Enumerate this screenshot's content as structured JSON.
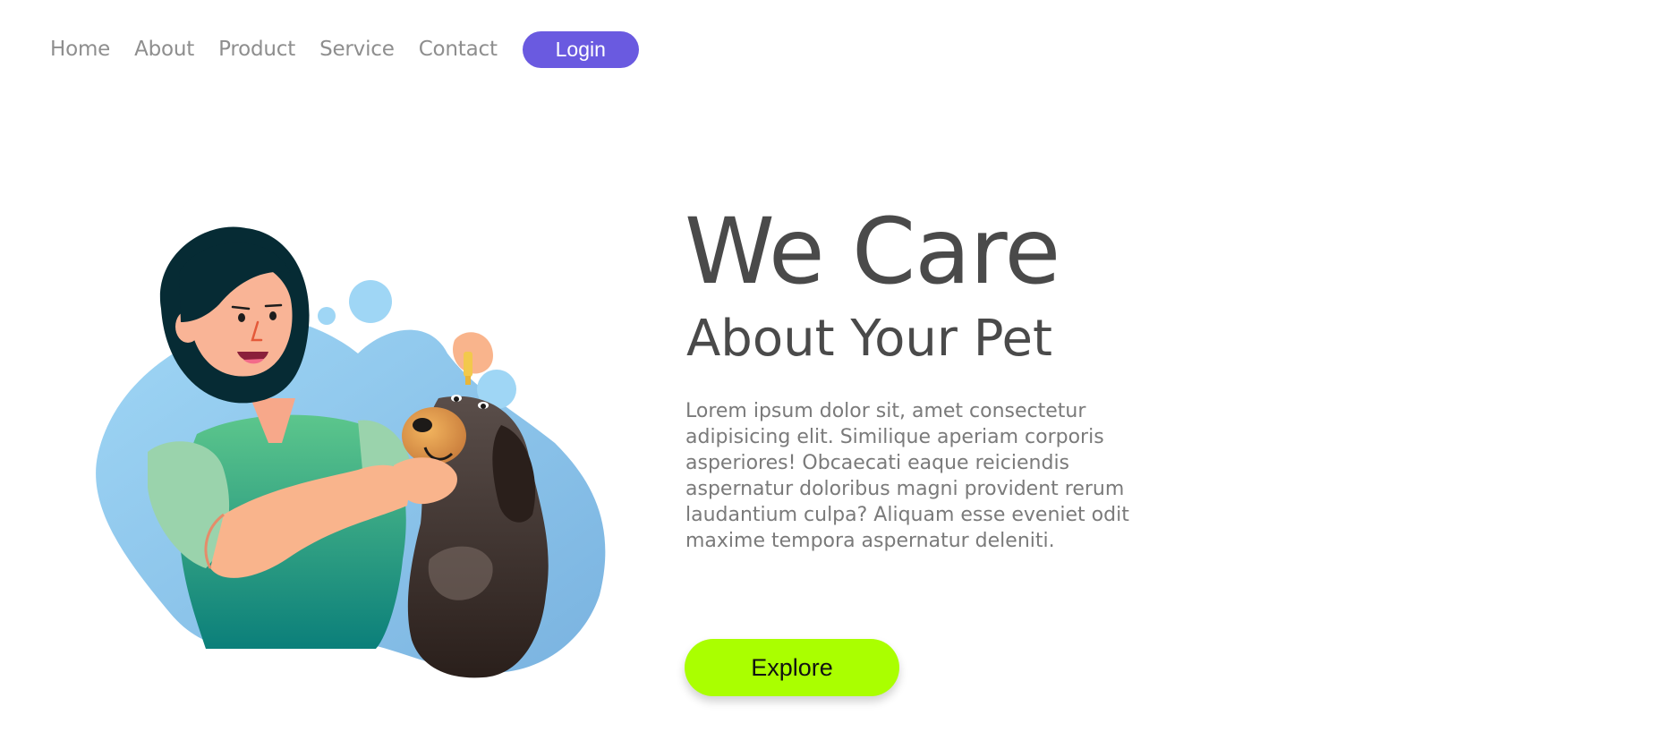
{
  "nav": {
    "links": [
      "Home",
      "About",
      "Product",
      "Service",
      "Contact"
    ],
    "login_label": "Login",
    "accent_color": "#6a5ae0"
  },
  "hero": {
    "title": "We Care",
    "subtitle": "About Your Pet",
    "body": "Lorem ipsum dolor sit, amet consectetur adipisicing elit. Similique aperiam corporis asperiores! Obcaecati eaque reiciendis aspernatur doloribus magni provident rerum laudantium culpa? Aliquam esse eveniet odit maxime tempora aspernatur deleniti.",
    "explore_label": "Explore",
    "explore_color": "#aaff00"
  },
  "illustration": {
    "icon": "woman-giving-dog-ear-drops-illustration"
  }
}
